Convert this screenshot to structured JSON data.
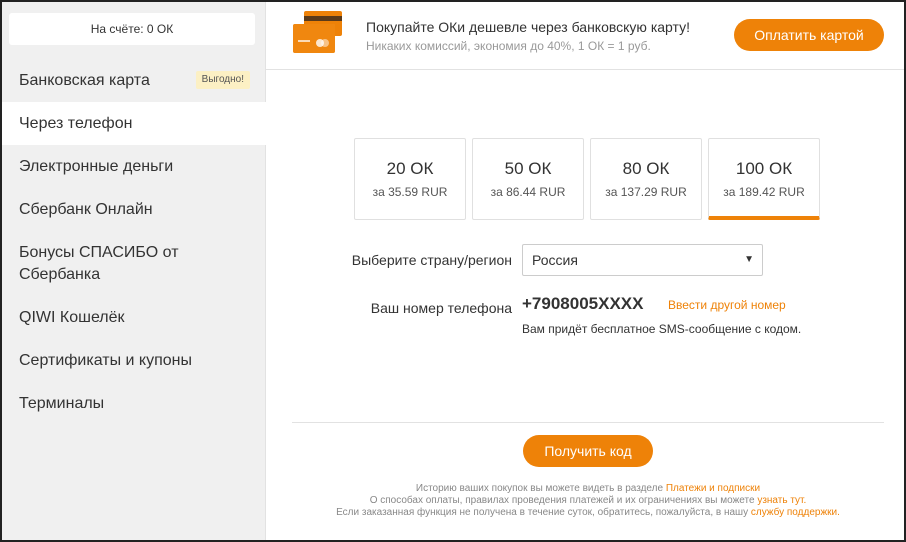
{
  "sidebar": {
    "balance": "На счёте: 0 ОК",
    "items": [
      {
        "label": "Банковская карта",
        "badge": "Выгодно!"
      },
      {
        "label": "Через телефон",
        "active": true
      },
      {
        "label": "Электронные деньги"
      },
      {
        "label": "Сбербанк Онлайн"
      },
      {
        "label": "Бонусы СПАСИБО от Сбербанка"
      },
      {
        "label": "QIWI Кошелёк"
      },
      {
        "label": "Сертификаты и купоны"
      },
      {
        "label": "Терминалы"
      }
    ]
  },
  "banner": {
    "title": "Покупайте ОКи дешевле через банковскую карту!",
    "subtitle": "Никаких комиссий, экономия до 40%, 1 ОК = 1 руб.",
    "button": "Оплатить картой",
    "icon": "credit-card-icon"
  },
  "packages": [
    {
      "amount": "20 ОК",
      "price": "за 35.59 RUR"
    },
    {
      "amount": "50 ОК",
      "price": "за 86.44 RUR"
    },
    {
      "amount": "80 ОК",
      "price": "за 137.29 RUR"
    },
    {
      "amount": "100 ОК",
      "price": "за 189.42 RUR",
      "selected": true
    }
  ],
  "form": {
    "country_label": "Выберите страну/регион",
    "country_value": "Россия",
    "phone_label": "Ваш номер телефона",
    "phone_value": "+7908005XXXX",
    "change_number": "Ввести другой номер",
    "sms_note": "Вам придёт бесплатное SMS-сообщение с кодом.",
    "submit": "Получить код"
  },
  "footer": {
    "line1_text": "Историю ваших покупок вы можете видеть в разделе",
    "line1_link": "Платежи и подписки",
    "line2_text": "О способах оплаты, правилах проведения платежей и их ограничениях вы можете",
    "line2_link": "узнать тут.",
    "line3_text": "Если заказанная функция не получена в течение суток, обратитесь, пожалуйста, в нашу",
    "line3_link": "службу поддержки."
  },
  "colors": {
    "accent": "#ee8208",
    "sidebar_bg": "#f0f0f0",
    "badge_bg": "#fcf0c4"
  }
}
